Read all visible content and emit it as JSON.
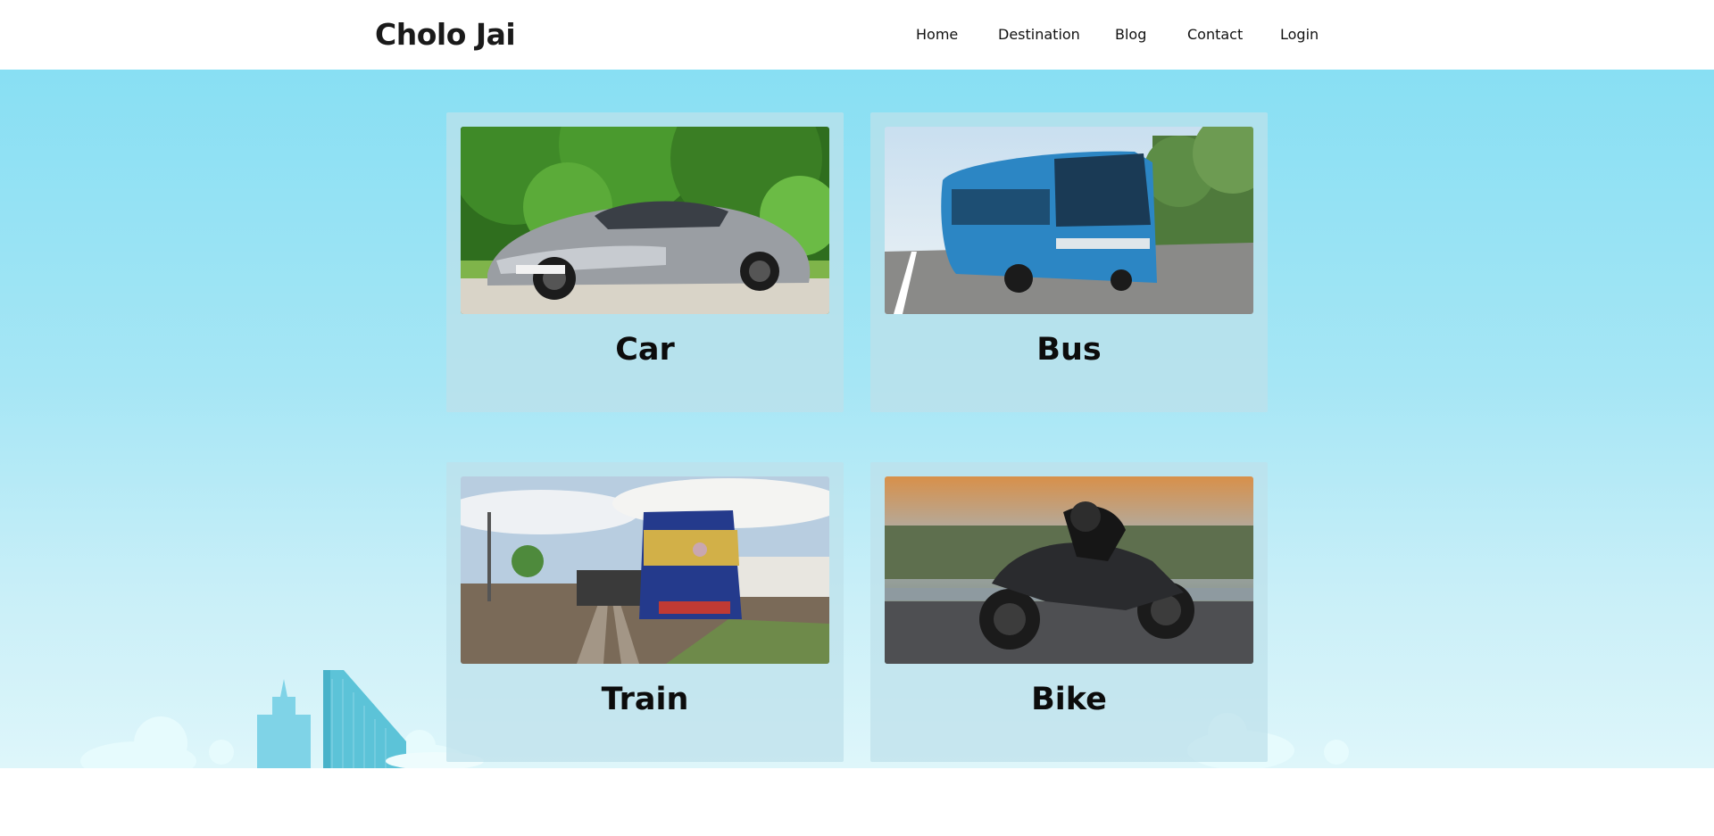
{
  "header": {
    "brand": "Cholo Jai",
    "nav": [
      {
        "label": "Home"
      },
      {
        "label": "Destination"
      },
      {
        "label": "Blog"
      },
      {
        "label": "Contact"
      },
      {
        "label": "Login"
      }
    ]
  },
  "colors": {
    "sky_top": "#88dff3",
    "sky_bottom": "#def6fa",
    "card_bg": "#bee1ea",
    "building": "#5cc3d8"
  },
  "cards": [
    {
      "title": "Car",
      "image": "silver-sports-car-photo"
    },
    {
      "title": "Bus",
      "image": "blue-coach-bus-photo"
    },
    {
      "title": "Train",
      "image": "blue-locomotive-train-photo"
    },
    {
      "title": "Bike",
      "image": "black-sport-motorbike-photo"
    }
  ]
}
